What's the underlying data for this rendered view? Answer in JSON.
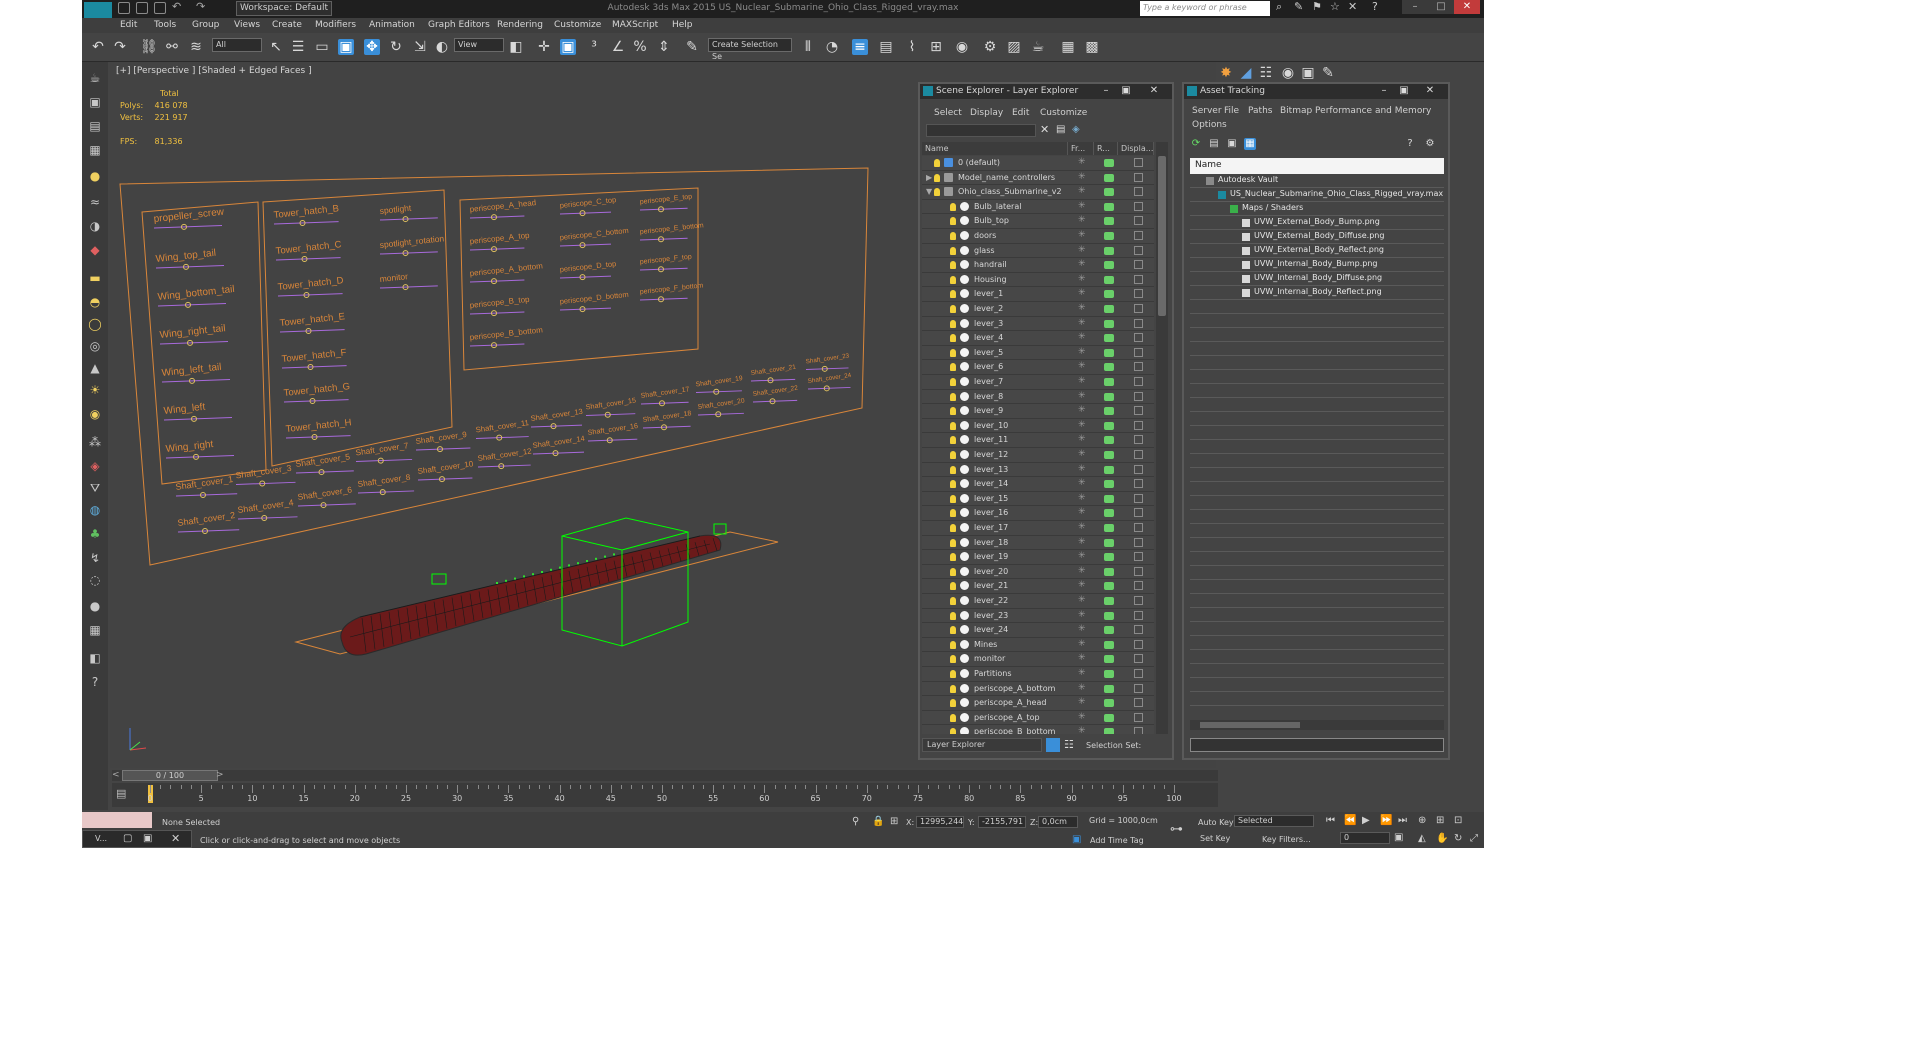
{
  "window": {
    "title": "Autodesk 3ds Max 2015     US_Nuclear_Submarine_Ohio_Class_Rigged_vray.max",
    "logo_text": "MAX",
    "workspace": "Workspace: Default",
    "search_placeholder": "Type a keyword or phrase"
  },
  "menu": [
    "Edit",
    "Tools",
    "Group",
    "Views",
    "Create",
    "Modifiers",
    "Animation",
    "Graph Editors",
    "Rendering",
    "Customize",
    "MAXScript",
    "Help"
  ],
  "toolbar": {
    "selection_filter": "All",
    "reference_coord": "View",
    "named_selection": "Create Selection Se"
  },
  "viewport": {
    "label": "[+] [Perspective ] [Shaded + Edged Faces ]",
    "stats": {
      "header": "Total",
      "polys_label": "Polys:",
      "polys": "416 078",
      "verts_label": "Verts:",
      "verts": "221 917",
      "fps_label": "FPS:",
      "fps": "81,336"
    },
    "controls": {
      "panel1": [
        "propeller_screw",
        "Wing_top_tail",
        "Wing_bottom_tail",
        "Wing_right_tail",
        "Wing_left_tail",
        "Wing_left",
        "Wing_right"
      ],
      "panel2": [
        "Tower_hatch_B",
        "Tower_hatch_C",
        "Tower_hatch_D",
        "Tower_hatch_E",
        "Tower_hatch_F",
        "Tower_hatch_G",
        "Tower_hatch_H"
      ],
      "panel2b": [
        "spotlight",
        "spotlight_rotation",
        "monitor"
      ],
      "panel3a": [
        "periscope_A_head",
        "periscope_A_top",
        "periscope_A_bottom",
        "periscope_B_top",
        "periscope_B_bottom"
      ],
      "panel3b": [
        "periscope_C_top",
        "periscope_C_bottom",
        "periscope_D_top",
        "periscope_D_bottom"
      ],
      "panel3c": [
        "periscope_E_top",
        "periscope_E_bottom",
        "periscope_F_top",
        "periscope_F_bottom"
      ],
      "shaft_top": [
        "Shaft_cover_1",
        "Shaft_cover_3",
        "Shaft_cover_5",
        "Shaft_cover_7",
        "Shaft_cover_9",
        "Shaft_cover_11",
        "Shaft_cover_13",
        "Shaft_cover_15",
        "Shaft_cover_17",
        "Shaft_cover_19",
        "Shaft_cover_21",
        "Shaft_cover_23"
      ],
      "shaft_bottom": [
        "Shaft_cover_2",
        "Shaft_cover_4",
        "Shaft_cover_6",
        "Shaft_cover_8",
        "Shaft_cover_10",
        "Shaft_cover_12",
        "Shaft_cover_14",
        "Shaft_cover_16",
        "Shaft_cover_18",
        "Shaft_cover_20",
        "Shaft_cover_22",
        "Shaft_cover_24"
      ]
    }
  },
  "timeline": {
    "slider": "0 / 100",
    "ticks": [
      "0",
      "5",
      "10",
      "15",
      "20",
      "25",
      "30",
      "35",
      "40",
      "45",
      "50",
      "55",
      "60",
      "65",
      "70",
      "75",
      "80",
      "85",
      "90",
      "95",
      "100"
    ]
  },
  "status": {
    "selection": "None Selected",
    "prompt": "Click or click-and-drag to select and move objects",
    "x_label": "X:",
    "x": "12995,244",
    "y_label": "Y:",
    "y": "-2155,791",
    "z_label": "Z:",
    "z": "0,0cm",
    "grid": "Grid = 1000,0cm",
    "add_time_tag": "Add Time Tag",
    "auto_key": "Auto Key",
    "auto_key_value": "Selected",
    "set_key": "Set Key",
    "key_filters": "Key Filters...",
    "frame": "0",
    "taskbar": "V..."
  },
  "scene_explorer": {
    "title": "Scene Explorer - Layer Explorer",
    "menu": [
      "Select",
      "Display",
      "Edit",
      "Customize"
    ],
    "columns": [
      "Name",
      "Fr...",
      "R...",
      "Displa..."
    ],
    "root_layers": [
      "0 (default)",
      "Model_name_controllers",
      "Ohio_class_Submarine_v2"
    ],
    "objects": [
      "Bulb_lateral",
      "Bulb_top",
      "doors",
      "glass",
      "handrail",
      "Housing",
      "lever_1",
      "lever_2",
      "lever_3",
      "lever_4",
      "lever_5",
      "lever_6",
      "lever_7",
      "lever_8",
      "lever_9",
      "lever_10",
      "lever_11",
      "lever_12",
      "lever_13",
      "lever_14",
      "lever_15",
      "lever_16",
      "lever_17",
      "lever_18",
      "lever_19",
      "lever_20",
      "lever_21",
      "lever_22",
      "lever_23",
      "lever_24",
      "Mines",
      "monitor",
      "Partitions",
      "periscope_A_bottom",
      "periscope_A_head",
      "periscope_A_top",
      "periscope_B_bottom"
    ],
    "footer_mode": "Layer Explorer",
    "footer_selection": "Selection Set:"
  },
  "asset_tracking": {
    "title": "Asset Tracking",
    "menu1": [
      "Server",
      "File",
      "Paths",
      "Bitmap Performance and Memory"
    ],
    "menu2": "Options",
    "column": "Name",
    "tree": [
      "Autodesk Vault",
      "US_Nuclear_Submarine_Ohio_Class_Rigged_vray.max",
      "Maps / Shaders"
    ],
    "files": [
      "UVW_External_Body_Bump.png",
      "UVW_External_Body_Diffuse.png",
      "UVW_External_Body_Reflect.png",
      "UVW_Internal_Body_Bump.png",
      "UVW_Internal_Body_Diffuse.png",
      "UVW_Internal_Body_Reflect.png"
    ]
  },
  "colors": {
    "ui_bg": "#444444",
    "wire_orange": "#d9863a",
    "selection_green": "#00ff00",
    "hull_red": "#6b1a1a",
    "accent_blue": "#3a8fd9"
  }
}
